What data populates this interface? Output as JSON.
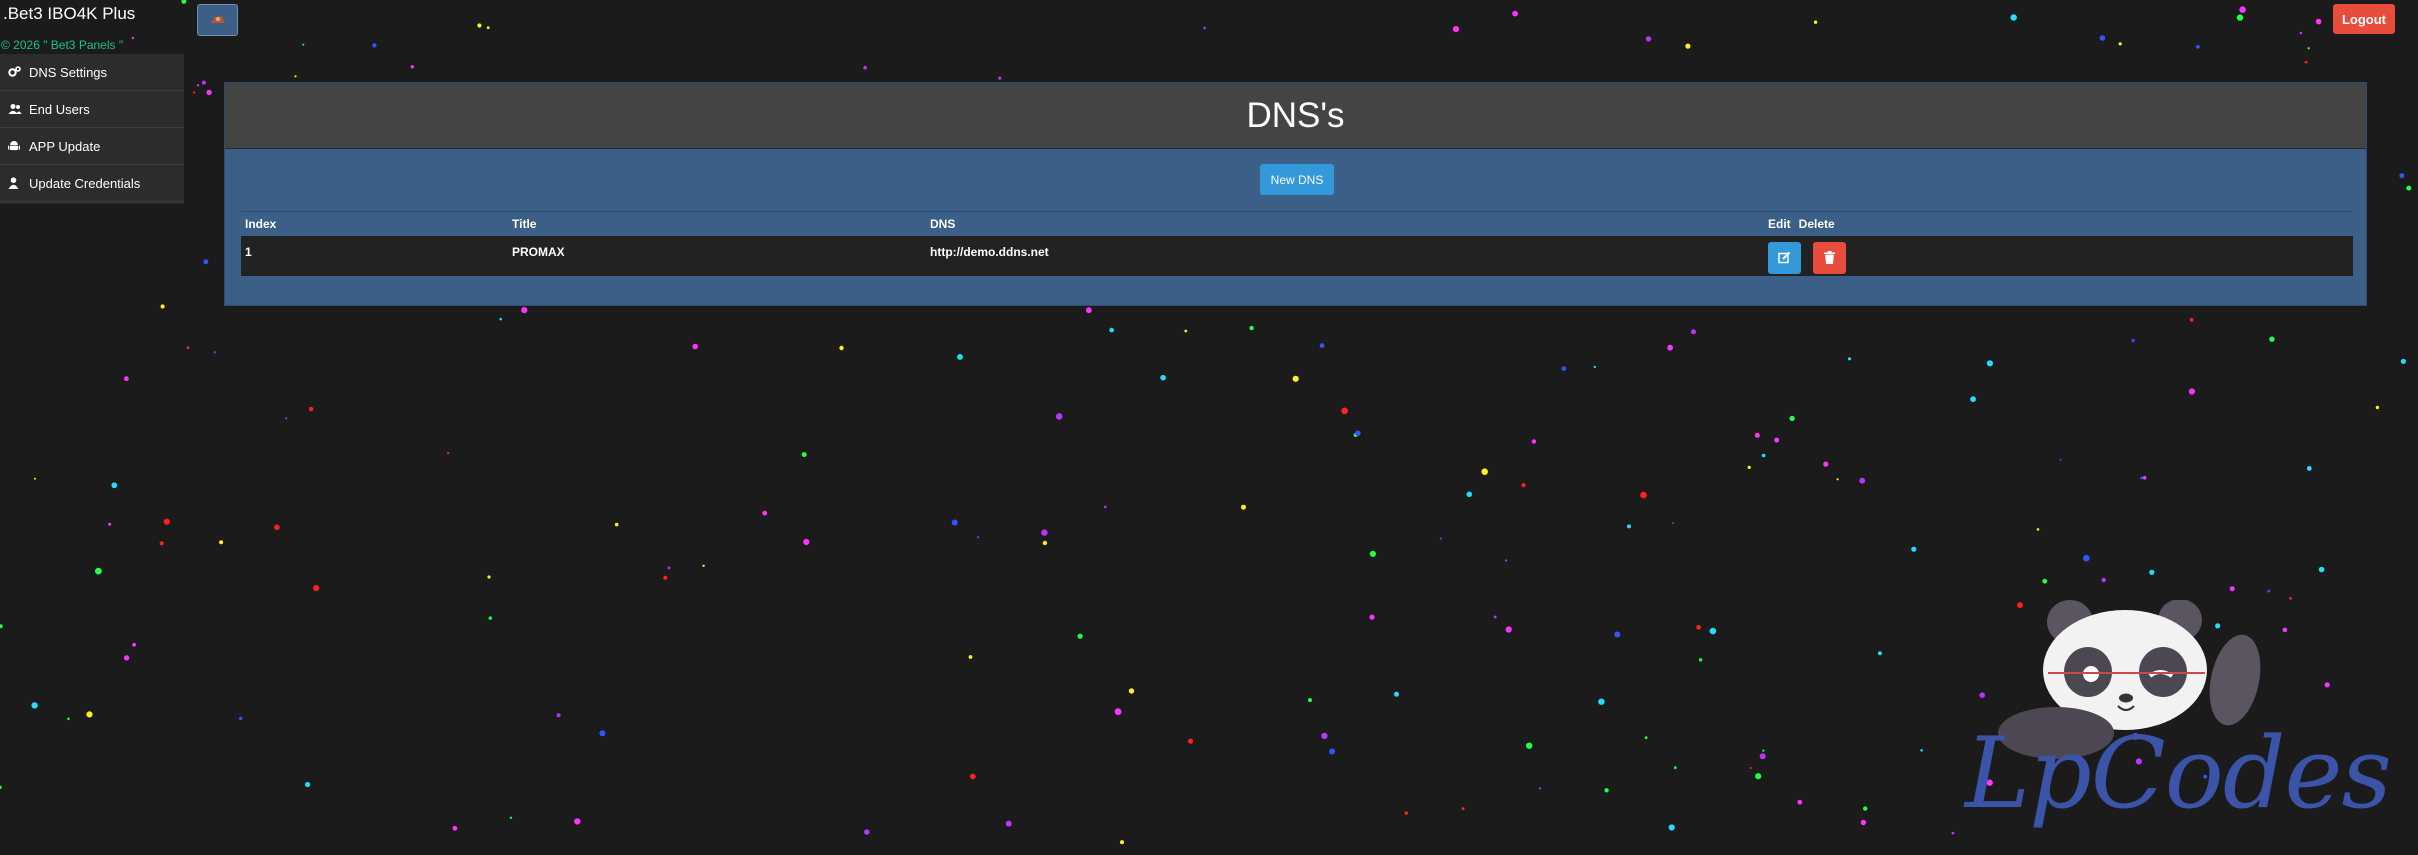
{
  "app": {
    "brand": ".Bet3 IBO4K Plus",
    "copyright": "© 2026 \" Bet3 Panels \""
  },
  "header": {
    "toggle_icon": "logo-icon",
    "logout_label": "Logout"
  },
  "sidebar": {
    "items": [
      {
        "label": "DNS Settings",
        "icon": "gears-icon"
      },
      {
        "label": "End Users",
        "icon": "users-icon"
      },
      {
        "label": "APP Update",
        "icon": "android-icon"
      },
      {
        "label": "Update Credentials",
        "icon": "user-icon"
      }
    ]
  },
  "main": {
    "title": "DNS's",
    "new_button": "New DNS",
    "table": {
      "columns": [
        "Index",
        "Title",
        "DNS",
        "Edit",
        "Delete"
      ],
      "rows": [
        {
          "index": "1",
          "title": "PROMAX",
          "dns": "http://demo.ddns.net"
        }
      ]
    }
  },
  "watermark": {
    "text": "LpCodes"
  },
  "colors": {
    "background": "#1b1b1b",
    "panel": "#3b5f86",
    "primary": "#3498db",
    "danger": "#e74c3c",
    "copyright": "#17c28a"
  }
}
